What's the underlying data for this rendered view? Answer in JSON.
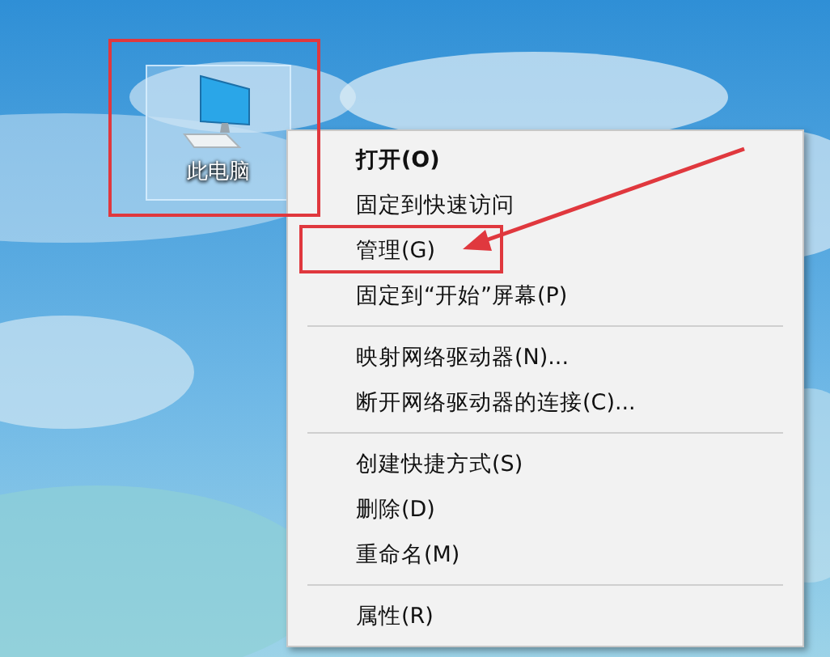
{
  "desktop_icon": {
    "label": "此电脑",
    "selected": true
  },
  "context_menu": {
    "sections": [
      [
        {
          "label": "打开(O)",
          "bold": true
        },
        {
          "label": "固定到快速访问",
          "bold": false
        },
        {
          "label": "管理(G)",
          "bold": false
        },
        {
          "label": "固定到“开始”屏幕(P)",
          "bold": false
        }
      ],
      [
        {
          "label": "映射网络驱动器(N)...",
          "bold": false
        },
        {
          "label": "断开网络驱动器的连接(C)...",
          "bold": false
        }
      ],
      [
        {
          "label": "创建快捷方式(S)",
          "bold": false
        },
        {
          "label": "删除(D)",
          "bold": false
        },
        {
          "label": "重命名(M)",
          "bold": false
        }
      ],
      [
        {
          "label": "属性(R)",
          "bold": false
        }
      ]
    ]
  }
}
